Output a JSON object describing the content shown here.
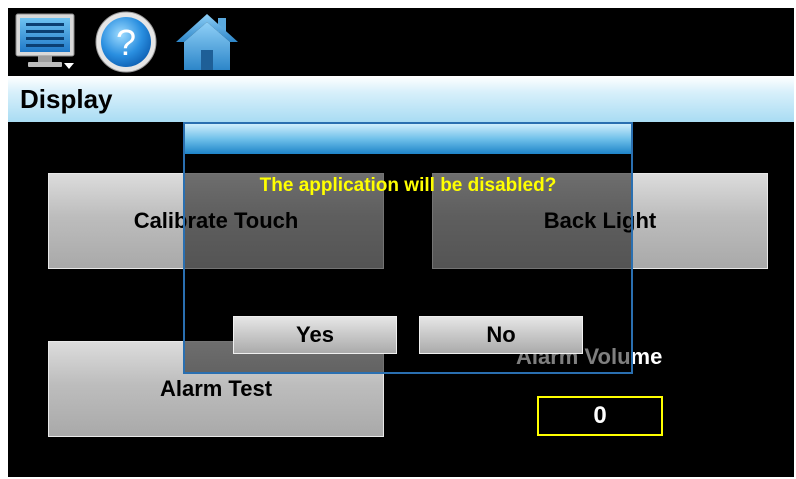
{
  "toolbar": {
    "menu_icon": "monitor-menu-icon",
    "help_icon": "help-icon",
    "home_icon": "home-icon"
  },
  "titlebar": {
    "title": "Display"
  },
  "buttons": {
    "calibrate_touch": "Calibrate Touch",
    "back_light": "Back Light",
    "alarm_test": "Alarm Test"
  },
  "alarm_volume": {
    "label": "Alarm Volume",
    "value": "0"
  },
  "dialog": {
    "message": "The application will be disabled?",
    "yes_label": "Yes",
    "no_label": "No"
  },
  "colors": {
    "background": "#000000",
    "title_bar": "#a9dcf3",
    "dialog_header": "#1e84c8",
    "dialog_text": "#ffff00",
    "value_border": "#ffff00"
  }
}
